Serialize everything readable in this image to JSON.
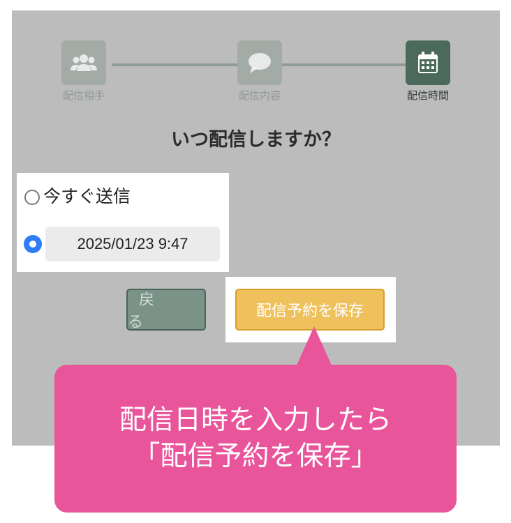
{
  "steps": [
    {
      "label": "配信相手",
      "icon": "users-icon",
      "state": "done"
    },
    {
      "label": "配信内容",
      "icon": "chat-bubble-icon",
      "state": "done"
    },
    {
      "label": "配信時間",
      "icon": "calendar-icon",
      "state": "active"
    }
  ],
  "question": "いつ配信しますか？",
  "options": {
    "now_label": "今すぐ送信",
    "scheduled_value": "2025/01/23 9:47",
    "selected": "scheduled"
  },
  "buttons": {
    "back_label": "戻 る",
    "save_label": "配信予約を保存"
  },
  "callout": {
    "line1": "配信日時を入力したら",
    "line2": "「配信予約を保存」"
  },
  "colors": {
    "panel": "#bcbcbc",
    "active_step": "#4b6a5b",
    "save_button": "#efc15d",
    "callout": "#e9559a",
    "radio_selected": "#2f7cf6"
  }
}
